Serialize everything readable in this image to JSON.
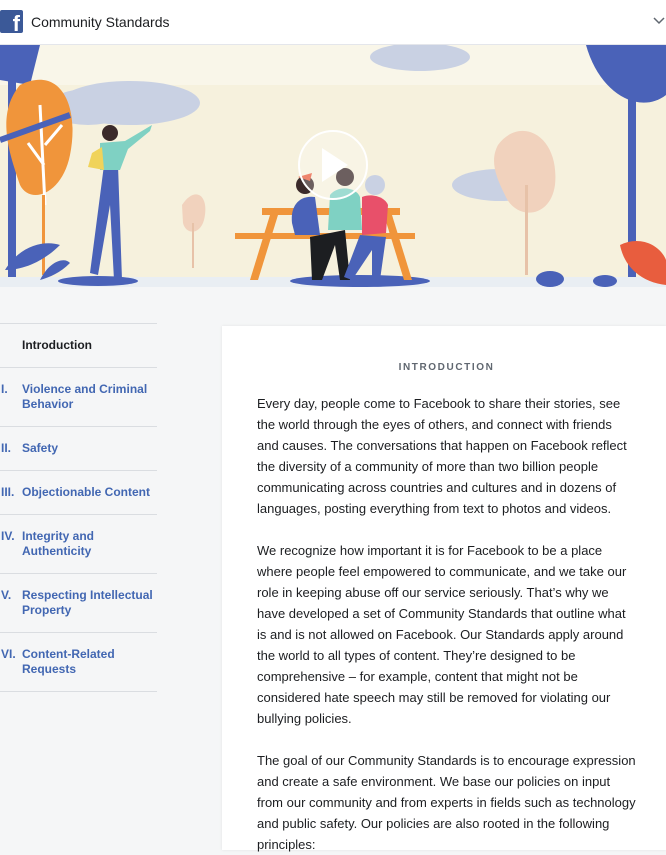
{
  "header": {
    "logo_letter": "f",
    "title": "Community Standards",
    "menu_icon": "chevron-down-icon"
  },
  "hero": {
    "play_icon": "play-icon"
  },
  "sidebar": {
    "items": [
      {
        "num": "",
        "label": "Introduction",
        "active": true
      },
      {
        "num": "I.",
        "label": "Violence and Criminal Behavior"
      },
      {
        "num": "II.",
        "label": "Safety"
      },
      {
        "num": "III.",
        "label": "Objectionable Content"
      },
      {
        "num": "IV.",
        "label": "Integrity and Authenticity"
      },
      {
        "num": "V.",
        "label": "Respecting Intellectual Property"
      },
      {
        "num": "VI.",
        "label": "Content-Related Requests"
      }
    ]
  },
  "main": {
    "section_label": "INTRODUCTION",
    "paragraphs": [
      "Every day, people come to Facebook to share their stories, see the world through the eyes of others, and connect with friends and causes. The conversations that happen on Facebook reflect the diversity of a community of more than two billion people communicating across countries and cultures and in dozens of languages, posting everything from text to photos and videos.",
      "We recognize how important it is for Facebook to be a place where people feel empowered to communicate, and we take our role in keeping abuse off our service seriously. That’s why we have developed a set of Community Standards that outline what is and is not allowed on Facebook. Our Standards apply around the world to all types of content. They’re designed to be comprehensive – for example, content that might not be considered hate speech may still be removed for violating our bullying policies.",
      "The goal of our Community Standards is to encourage expression and create a safe environment. We base our policies on input from our community and from experts in fields such as technology and public safety. Our policies are also rooted in the following principles:"
    ]
  },
  "colors": {
    "brand": "#3b5998",
    "link": "#4267b2",
    "hero_bg": "#f6f1dd",
    "orange": "#f0953b",
    "blue_shape": "#4a62b8"
  }
}
